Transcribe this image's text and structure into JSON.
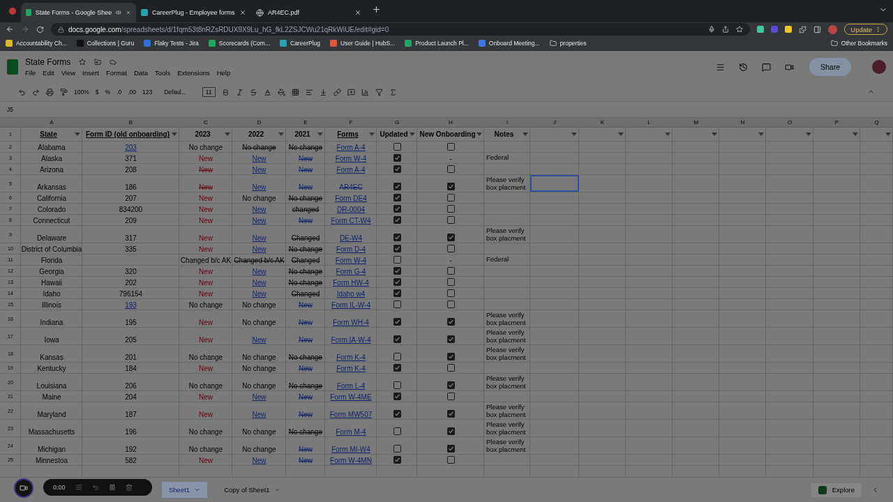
{
  "browser": {
    "tabs": [
      {
        "title": "State Forms - Google Shee",
        "selected": true,
        "kind": "sheets"
      },
      {
        "title": "CareerPlug - Employee forms",
        "selected": false,
        "kind": "careerplug"
      },
      {
        "title": "AR4EC.pdf",
        "selected": false,
        "kind": "globe"
      }
    ],
    "url": {
      "host": "docs.google.com",
      "path": "/spreadsheets/d/1fqm53t8nRZsRDUX9X9Lu_hG_fkL2ZSJCWu21qRkWiUE/edit#gid=0"
    },
    "update_button": "Update",
    "bookmarks": [
      {
        "label": "Accountability Ch...",
        "kind": "yellow"
      },
      {
        "label": "Collections | Guru",
        "kind": "guru"
      },
      {
        "label": "Flaky Tests - Jira",
        "kind": "jira"
      },
      {
        "label": "Scorecards (Com...",
        "kind": "sheets"
      },
      {
        "label": "CareerPlug",
        "kind": "careerplug"
      },
      {
        "label": "User Guide | HubS...",
        "kind": "hubspot"
      },
      {
        "label": "Product Launch Pl...",
        "kind": "sheets"
      },
      {
        "label": "Onboard Meeting...",
        "kind": "docs"
      },
      {
        "label": "properties",
        "kind": "folder"
      }
    ],
    "other_bookmarks": "Other Bookmarks"
  },
  "app": {
    "title": "State Forms",
    "menu": [
      "File",
      "Edit",
      "View",
      "Insert",
      "Format",
      "Data",
      "Tools",
      "Extensions",
      "Help"
    ],
    "share": "Share",
    "toolbar": {
      "zoom": "100%",
      "currency": "$",
      "percent": "%",
      "decrease_decimals": ".0",
      "increase_decimals": ".00",
      "number_format": "123",
      "font": "Defaul...",
      "font_size": "11"
    },
    "cell_ref": "J5"
  },
  "sheet": {
    "column_letters": [
      "A",
      "B",
      "C",
      "D",
      "E",
      "F",
      "G",
      "H",
      "I",
      "J",
      "K",
      "L",
      "M",
      "N",
      "O",
      "P",
      "Q"
    ],
    "header_row_number": "1",
    "headers": [
      {
        "label": "State",
        "kind": "underlined"
      },
      {
        "label": "Form ID (old onboarding)",
        "kind": "underlined"
      },
      {
        "label": "2023",
        "kind": "plain"
      },
      {
        "label": "2022",
        "kind": "plain"
      },
      {
        "label": "2021",
        "kind": "plain"
      },
      {
        "label": "Forms",
        "kind": "underlined"
      },
      {
        "label": "Updated",
        "kind": "plain"
      },
      {
        "label": "New Onboarding",
        "kind": "plain"
      },
      {
        "label": "Notes",
        "kind": "plain"
      }
    ],
    "rows": [
      {
        "number": "2",
        "state": "Alabama",
        "id": {
          "text": "203",
          "kind": "link"
        },
        "y2023": {
          "text": "No change",
          "kind": "plain"
        },
        "y2022": {
          "text": "No change",
          "kind": "strike"
        },
        "y2021": {
          "text": "No change",
          "kind": "strike"
        },
        "form": {
          "text": "Form A-4",
          "kind": "link"
        },
        "updated": false,
        "onboarding": {
          "kind": "checkbox",
          "checked": false
        },
        "selected": false
      },
      {
        "number": "3",
        "state": "Alaska",
        "id": {
          "text": "371",
          "kind": "plain"
        },
        "y2023": {
          "text": "New",
          "kind": "red"
        },
        "y2022": {
          "text": "New",
          "kind": "link"
        },
        "y2021": {
          "text": "New",
          "kind": "linkstrike"
        },
        "form": {
          "text": "Form W-4",
          "kind": "link"
        },
        "updated": true,
        "onboarding": {
          "kind": "dash",
          "text": "-"
        },
        "notes": "Federal",
        "selected": false
      },
      {
        "number": "4",
        "state": "Arizona",
        "id": {
          "text": "208",
          "kind": "plain"
        },
        "y2023": {
          "text": "New",
          "kind": "redstrike"
        },
        "y2022": {
          "text": "New",
          "kind": "link"
        },
        "y2021": {
          "text": "New",
          "kind": "linkstrike"
        },
        "form": {
          "text": "Form A-4",
          "kind": "link"
        },
        "updated": true,
        "onboarding": {
          "kind": "checkbox",
          "checked": false
        },
        "selected": false
      },
      {
        "number": "5",
        "state": "Arkansas",
        "id": {
          "text": "186",
          "kind": "plain"
        },
        "y2023": {
          "text": "New",
          "kind": "redstrike"
        },
        "y2022": {
          "text": "New",
          "kind": "link"
        },
        "y2021": {
          "text": "New",
          "kind": "linkstrike"
        },
        "form": {
          "text": "AR4EC",
          "kind": "linkstrike"
        },
        "updated": true,
        "onboarding": {
          "kind": "checkbox",
          "checked": true
        },
        "notes": "Please verify box placment",
        "selected": true
      },
      {
        "number": "6",
        "state": "California",
        "id": {
          "text": "207",
          "kind": "plain"
        },
        "y2023": {
          "text": "New",
          "kind": "red"
        },
        "y2022": {
          "text": "No change",
          "kind": "plain"
        },
        "y2021": {
          "text": "No change",
          "kind": "strike"
        },
        "form": {
          "text": "Form DE4",
          "kind": "link"
        },
        "updated": true,
        "onboarding": {
          "kind": "checkbox",
          "checked": false
        },
        "selected": false
      },
      {
        "number": "7",
        "state": "Colorado",
        "id": {
          "text": "834200",
          "kind": "plain"
        },
        "y2023": {
          "text": "New",
          "kind": "red"
        },
        "y2022": {
          "text": "New",
          "kind": "link"
        },
        "y2021": {
          "text": "changed",
          "kind": "strike"
        },
        "form": {
          "text": "DR-0004",
          "kind": "link"
        },
        "updated": true,
        "onboarding": {
          "kind": "checkbox",
          "checked": false
        },
        "selected": false
      },
      {
        "number": "8",
        "state": "Connecticut",
        "id": {
          "text": "209",
          "kind": "plain"
        },
        "y2023": {
          "text": "New",
          "kind": "red"
        },
        "y2022": {
          "text": "New",
          "kind": "link"
        },
        "y2021": {
          "text": "New",
          "kind": "linkstrike"
        },
        "form": {
          "text": "Form CT-W4",
          "kind": "link"
        },
        "updated": true,
        "onboarding": {
          "kind": "checkbox",
          "checked": false
        },
        "selected": false
      },
      {
        "number": "9",
        "state": "Delaware",
        "id": {
          "text": "317",
          "kind": "plain"
        },
        "y2023": {
          "text": "New",
          "kind": "red"
        },
        "y2022": {
          "text": "New",
          "kind": "link"
        },
        "y2021": {
          "text": "Changed",
          "kind": "strike"
        },
        "form": {
          "text": "DE-W4",
          "kind": "link"
        },
        "updated": true,
        "onboarding": {
          "kind": "checkbox",
          "checked": true
        },
        "notes": "Please verify box placment",
        "selected": false
      },
      {
        "number": "10",
        "state": "District of Columbia",
        "id": {
          "text": "335",
          "kind": "plain"
        },
        "y2023": {
          "text": "New",
          "kind": "red"
        },
        "y2022": {
          "text": "New",
          "kind": "link"
        },
        "y2021": {
          "text": "No change",
          "kind": "strike"
        },
        "form": {
          "text": "Form D-4",
          "kind": "link"
        },
        "updated": true,
        "onboarding": {
          "kind": "checkbox",
          "checked": false
        },
        "selected": false
      },
      {
        "number": "11",
        "state": "Florida",
        "y2023": {
          "text": "Changed b/c AK",
          "kind": "plain"
        },
        "y2022": {
          "text": "Changed b/c AK",
          "kind": "strike"
        },
        "y2021": {
          "text": "Changed",
          "kind": "strike"
        },
        "form": {
          "text": "Form W-4",
          "kind": "link"
        },
        "updated": false,
        "onboarding": {
          "kind": "dash",
          "text": "-"
        },
        "notes": "Federal",
        "selected": false
      },
      {
        "number": "12",
        "state": "Georgia",
        "id": {
          "text": "320",
          "kind": "plain"
        },
        "y2023": {
          "text": "New",
          "kind": "red"
        },
        "y2022": {
          "text": "New",
          "kind": "link"
        },
        "y2021": {
          "text": "No change",
          "kind": "strike"
        },
        "form": {
          "text": "Form G-4",
          "kind": "link"
        },
        "updated": true,
        "onboarding": {
          "kind": "checkbox",
          "checked": false
        },
        "selected": false
      },
      {
        "number": "13",
        "state": "Hawaii",
        "id": {
          "text": "202",
          "kind": "plain"
        },
        "y2023": {
          "text": "New",
          "kind": "red"
        },
        "y2022": {
          "text": "New",
          "kind": "link"
        },
        "y2021": {
          "text": "No change",
          "kind": "strike"
        },
        "form": {
          "text": "Form HW-4",
          "kind": "link"
        },
        "updated": true,
        "onboarding": {
          "kind": "checkbox",
          "checked": false
        },
        "selected": false
      },
      {
        "number": "14",
        "state": "Idaho",
        "id": {
          "text": "796154",
          "kind": "plain"
        },
        "y2023": {
          "text": "New",
          "kind": "red"
        },
        "y2022": {
          "text": "New",
          "kind": "link"
        },
        "y2021": {
          "text": "Changed",
          "kind": "strike"
        },
        "form": {
          "text": "Idaho w4",
          "kind": "link"
        },
        "updated": true,
        "onboarding": {
          "kind": "checkbox",
          "checked": false
        },
        "selected": false
      },
      {
        "number": "15",
        "state": "Illinois",
        "id": {
          "text": "193",
          "kind": "link"
        },
        "y2023": {
          "text": "No change",
          "kind": "plain"
        },
        "y2022": {
          "text": "No change",
          "kind": "plain"
        },
        "y2021": {
          "text": "New",
          "kind": "linkstrike"
        },
        "form": {
          "text": "Form IL-W-4",
          "kind": "link"
        },
        "updated": false,
        "onboarding": {
          "kind": "checkbox",
          "checked": false
        },
        "selected": false
      },
      {
        "number": "16",
        "state": "Indiana",
        "id": {
          "text": "195",
          "kind": "plain"
        },
        "y2023": {
          "text": "New",
          "kind": "red"
        },
        "y2022": {
          "text": "No change",
          "kind": "plain"
        },
        "y2021": {
          "text": "New",
          "kind": "linkstrike"
        },
        "form": {
          "text": "Form WH-4",
          "kind": "link"
        },
        "updated": true,
        "onboarding": {
          "kind": "checkbox",
          "checked": true
        },
        "notes": "Please verify box placment",
        "selected": false
      },
      {
        "number": "17",
        "state": "Iowa",
        "id": {
          "text": "205",
          "kind": "plain"
        },
        "y2023": {
          "text": "New",
          "kind": "red"
        },
        "y2022": {
          "text": "New",
          "kind": "link"
        },
        "y2021": {
          "text": "New",
          "kind": "linkstrike"
        },
        "form": {
          "text": "Form IA-W-4",
          "kind": "link"
        },
        "updated": true,
        "onboarding": {
          "kind": "checkbox",
          "checked": true
        },
        "notes": "Please verify box placment",
        "selected": false
      },
      {
        "number": "18",
        "state": "Kansas",
        "id": {
          "text": "201",
          "kind": "plain"
        },
        "y2023": {
          "text": "No change",
          "kind": "plain"
        },
        "y2022": {
          "text": "No change",
          "kind": "plain"
        },
        "y2021": {
          "text": "No change",
          "kind": "strike"
        },
        "form": {
          "text": "Form K-4",
          "kind": "link"
        },
        "updated": false,
        "onboarding": {
          "kind": "checkbox",
          "checked": true
        },
        "notes": "Please verify box placment",
        "selected": false
      },
      {
        "number": "19",
        "state": "Kentucky",
        "id": {
          "text": "184",
          "kind": "plain"
        },
        "y2023": {
          "text": "New",
          "kind": "red"
        },
        "y2022": {
          "text": "No change",
          "kind": "plain"
        },
        "y2021": {
          "text": "New",
          "kind": "linkstrike"
        },
        "form": {
          "text": "Form K-4",
          "kind": "link"
        },
        "updated": true,
        "onboarding": {
          "kind": "checkbox",
          "checked": false
        },
        "selected": false
      },
      {
        "number": "20",
        "state": "Louisiana",
        "id": {
          "text": "206",
          "kind": "plain"
        },
        "y2023": {
          "text": "No change",
          "kind": "plain"
        },
        "y2022": {
          "text": "No change",
          "kind": "plain"
        },
        "y2021": {
          "text": "No change",
          "kind": "strike"
        },
        "form": {
          "text": "Form L-4",
          "kind": "link"
        },
        "updated": false,
        "onboarding": {
          "kind": "checkbox",
          "checked": true
        },
        "notes": "Please verify box placment",
        "selected": false
      },
      {
        "number": "21",
        "state": "Maine",
        "id": {
          "text": "204",
          "kind": "plain"
        },
        "y2023": {
          "text": "New",
          "kind": "red"
        },
        "y2022": {
          "text": "New",
          "kind": "link"
        },
        "y2021": {
          "text": "New",
          "kind": "linkstrike"
        },
        "form": {
          "text": "Form W-4ME",
          "kind": "link"
        },
        "updated": true,
        "onboarding": {
          "kind": "checkbox",
          "checked": false
        },
        "selected": false
      },
      {
        "number": "22",
        "state": "Maryland",
        "id": {
          "text": "187",
          "kind": "plain"
        },
        "y2023": {
          "text": "New",
          "kind": "red"
        },
        "y2022": {
          "text": "New",
          "kind": "link"
        },
        "y2021": {
          "text": "New",
          "kind": "linkstrike"
        },
        "form": {
          "text": "Form MW507",
          "kind": "link"
        },
        "updated": true,
        "onboarding": {
          "kind": "checkbox",
          "checked": true
        },
        "notes": "Please verify box placment",
        "selected": false
      },
      {
        "number": "23",
        "state": "Massachusetts",
        "id": {
          "text": "196",
          "kind": "plain"
        },
        "y2023": {
          "text": "No change",
          "kind": "plain"
        },
        "y2022": {
          "text": "No change",
          "kind": "plain"
        },
        "y2021": {
          "text": "No change",
          "kind": "strike"
        },
        "form": {
          "text": "Form M-4",
          "kind": "link"
        },
        "updated": false,
        "onboarding": {
          "kind": "checkbox",
          "checked": true
        },
        "notes": "Please verify box placment",
        "selected": false
      },
      {
        "number": "24",
        "state": "Michigan",
        "id": {
          "text": "192",
          "kind": "plain"
        },
        "y2023": {
          "text": "No change",
          "kind": "plain"
        },
        "y2022": {
          "text": "No change",
          "kind": "plain"
        },
        "y2021": {
          "text": "New",
          "kind": "linkstrike"
        },
        "form": {
          "text": "Form MI-W4",
          "kind": "link"
        },
        "updated": false,
        "onboarding": {
          "kind": "checkbox",
          "checked": true
        },
        "notes": "Please verify box placment",
        "selected": false
      },
      {
        "number": "25",
        "state": "Minnestoa",
        "id": {
          "text": "582",
          "kind": "plain"
        },
        "y2023": {
          "text": "New",
          "kind": "red"
        },
        "y2022": {
          "text": "New",
          "kind": "link"
        },
        "y2021": {
          "text": "New",
          "kind": "linkstrike"
        },
        "form": {
          "text": "Form W-4MN",
          "kind": "link"
        },
        "updated": true,
        "onboarding": {
          "kind": "checkbox",
          "checked": false
        },
        "selected": false
      }
    ]
  },
  "bottom": {
    "sheet_tabs": [
      {
        "label": "Sheet1",
        "selected": true
      },
      {
        "label": "Copy of Sheet1",
        "selected": false
      }
    ],
    "explore": "Explore"
  },
  "recorder": {
    "time": "0:00"
  }
}
